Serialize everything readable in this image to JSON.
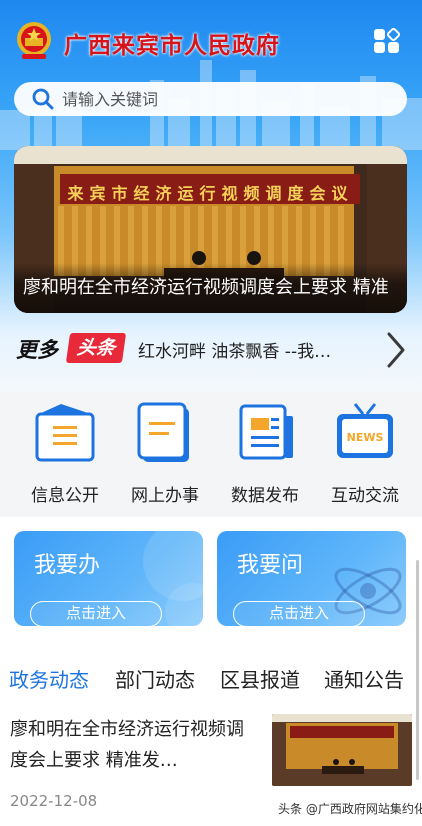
{
  "header": {
    "title": "广西来宾市人民政府",
    "brand_red": "#d7141c",
    "search_placeholder": "请输入关键词"
  },
  "banner": {
    "sign_text": "来宾市经济运行视频调度会议",
    "caption": "廖和明在全市经济运行视频调度会上要求 精准"
  },
  "ticker": {
    "more_label": "更多",
    "badge_label": "头条",
    "headline": "红水河畔 油茶飘香 --我…"
  },
  "quick_links": [
    {
      "label": "信息公开",
      "icon": "info-folder-icon"
    },
    {
      "label": "网上办事",
      "icon": "document-icon"
    },
    {
      "label": "数据发布",
      "icon": "newspaper-icon"
    },
    {
      "label": "互动交流",
      "icon": "news-tv-icon"
    }
  ],
  "cards": [
    {
      "title": "我要办",
      "button": "点击进入"
    },
    {
      "title": "我要问",
      "button": "点击进入"
    }
  ],
  "tabs": [
    {
      "label": "政务动态",
      "active": true
    },
    {
      "label": "部门动态",
      "active": false
    },
    {
      "label": "区县报道",
      "active": false
    },
    {
      "label": "通知公告",
      "active": false
    }
  ],
  "news": [
    {
      "title": "廖和明在全市经济运行视频调度会上要求 精准发…",
      "date": "2022-12-08"
    }
  ],
  "watermark": "头条 @广西政府网站集约化",
  "colors": {
    "accent": "#1d74e0",
    "badge": "#e8293a"
  }
}
